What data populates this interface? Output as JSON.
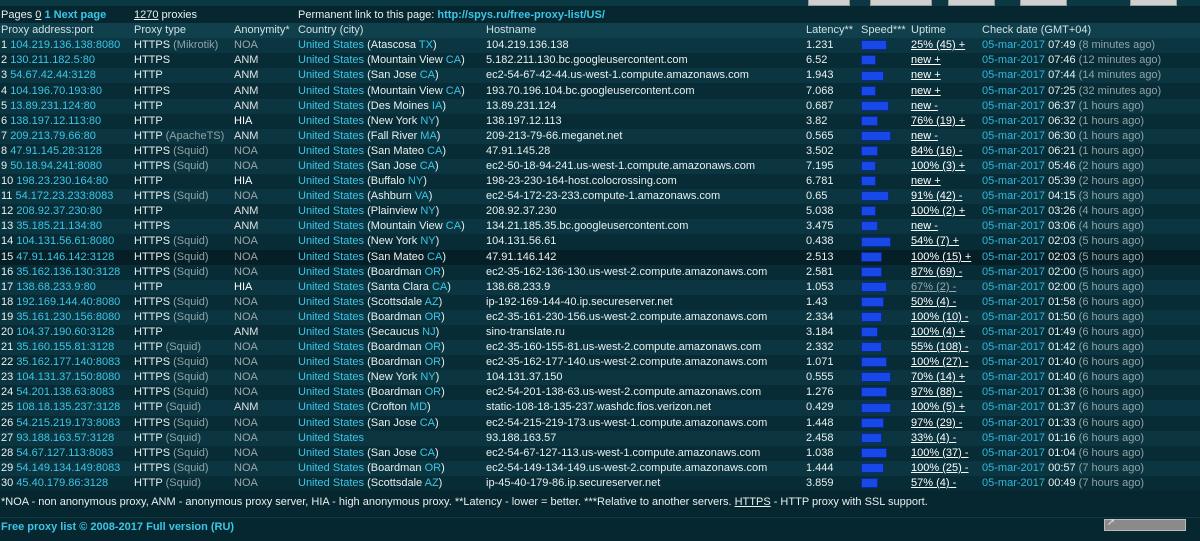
{
  "top": {
    "pages_label": "Pages",
    "current_page": "0",
    "next_page": "1 Next page",
    "total_proxies": "1270",
    "proxies_label": "proxies",
    "permalink_label": "Permanent link to this page:",
    "permalink": "http://spys.ru/free-proxy-list/US/"
  },
  "headers": [
    "Proxy address:port",
    "Proxy type",
    "Anonymity*",
    "Country (city)",
    "Hostname",
    "Latency**",
    "Speed***",
    "Uptime",
    "Check date (GMT+04)"
  ],
  "rows": [
    {
      "n": "1",
      "ip": "104.219.136.138:8080",
      "type": "HTTPS",
      "sub": "(Mikrotik)",
      "anon": "NOA",
      "country": "United States",
      "city": "Atascosa",
      "state": "TX",
      "host": "104.219.136.138",
      "lat": "1.231",
      "speed": 0.8,
      "uptime": "25% (45) +",
      "date": "05-mar-2017",
      "time": "07:49",
      "ago": "(8 minutes ago)"
    },
    {
      "n": "2",
      "ip": "130.211.182.5:80",
      "type": "HTTPS",
      "sub": "",
      "anon": "ANM",
      "country": "United States",
      "city": "Mountain View",
      "state": "CA",
      "host": "5.182.211.130.bc.googleusercontent.com",
      "lat": "6.52",
      "speed": 0.3,
      "uptime": "new +",
      "date": "05-mar-2017",
      "time": "07:46",
      "ago": "(12 minutes ago)"
    },
    {
      "n": "3",
      "ip": "54.67.42.44:3128",
      "type": "HTTP",
      "sub": "",
      "anon": "ANM",
      "country": "United States",
      "city": "San Jose",
      "state": "CA",
      "host": "ec2-54-67-42-44.us-west-1.compute.amazonaws.com",
      "lat": "1.943",
      "speed": 0.7,
      "uptime": "new +",
      "date": "05-mar-2017",
      "time": "07:44",
      "ago": "(14 minutes ago)"
    },
    {
      "n": "4",
      "ip": "104.196.70.193:80",
      "type": "HTTPS",
      "sub": "",
      "anon": "ANM",
      "country": "United States",
      "city": "Mountain View",
      "state": "CA",
      "host": "193.70.196.104.bc.googleusercontent.com",
      "lat": "7.068",
      "speed": 0.3,
      "uptime": "new +",
      "date": "05-mar-2017",
      "time": "07:25",
      "ago": "(32 minutes ago)"
    },
    {
      "n": "5",
      "ip": "13.89.231.124:80",
      "type": "HTTP",
      "sub": "",
      "anon": "ANM",
      "country": "United States",
      "city": "Des Moines",
      "state": "IA",
      "host": "13.89.231.124",
      "lat": "0.687",
      "speed": 0.9,
      "uptime": "new -",
      "date": "05-mar-2017",
      "time": "06:37",
      "ago": "(1 hours ago)"
    },
    {
      "n": "6",
      "ip": "138.197.12.113:80",
      "type": "HTTP",
      "sub": "",
      "anon": "HIA",
      "country": "United States",
      "city": "New York",
      "state": "NY",
      "host": "138.197.12.113",
      "lat": "3.82",
      "speed": 0.4,
      "uptime": "76% (19) +",
      "date": "05-mar-2017",
      "time": "06:32",
      "ago": "(1 hours ago)"
    },
    {
      "n": "7",
      "ip": "209.213.79.66:80",
      "type": "HTTP",
      "sub": "(ApacheTS)",
      "anon": "ANM",
      "country": "United States",
      "city": "Fall River",
      "state": "MA",
      "host": "209-213-79-66.meganet.net",
      "lat": "0.565",
      "speed": 1.0,
      "uptime": "new -",
      "date": "05-mar-2017",
      "time": "06:30",
      "ago": "(1 hours ago)"
    },
    {
      "n": "8",
      "ip": "47.91.145.28:3128",
      "type": "HTTPS",
      "sub": "(Squid)",
      "anon": "NOA",
      "country": "United States",
      "city": "San Mateo",
      "state": "CA",
      "host": "47.91.145.28",
      "lat": "3.502",
      "speed": 0.4,
      "uptime": "84% (16) -",
      "date": "05-mar-2017",
      "time": "06:21",
      "ago": "(1 hours ago)"
    },
    {
      "n": "9",
      "ip": "50.18.94.241:8080",
      "type": "HTTPS",
      "sub": "(Squid)",
      "anon": "NOA",
      "country": "United States",
      "city": "San Jose",
      "state": "CA",
      "host": "ec2-50-18-94-241.us-west-1.compute.amazonaws.com",
      "lat": "7.195",
      "speed": 0.3,
      "uptime": "100% (3) +",
      "date": "05-mar-2017",
      "time": "05:46",
      "ago": "(2 hours ago)"
    },
    {
      "n": "10",
      "ip": "198.23.230.164:80",
      "type": "HTTP",
      "sub": "",
      "anon": "HIA",
      "country": "United States",
      "city": "Buffalo",
      "state": "NY",
      "host": "198-23-230-164-host.colocrossing.com",
      "lat": "6.781",
      "speed": 0.3,
      "uptime": "new +",
      "date": "05-mar-2017",
      "time": "05:39",
      "ago": "(2 hours ago)"
    },
    {
      "n": "11",
      "ip": "54.172.23.233:8083",
      "type": "HTTPS",
      "sub": "(Squid)",
      "anon": "NOA",
      "country": "United States",
      "city": "Ashburn",
      "state": "VA",
      "host": "ec2-54-172-23-233.compute-1.amazonaws.com",
      "lat": "0.65",
      "speed": 0.9,
      "uptime": "91% (42) -",
      "date": "05-mar-2017",
      "time": "04:15",
      "ago": "(3 hours ago)"
    },
    {
      "n": "12",
      "ip": "208.92.37.230:80",
      "type": "HTTP",
      "sub": "",
      "anon": "ANM",
      "country": "United States",
      "city": "Plainview",
      "state": "NY",
      "host": "208.92.37.230",
      "lat": "5.038",
      "speed": 0.3,
      "uptime": "100% (2) +",
      "date": "05-mar-2017",
      "time": "03:26",
      "ago": "(4 hours ago)"
    },
    {
      "n": "13",
      "ip": "35.185.21.134:80",
      "type": "HTTPS",
      "sub": "",
      "anon": "ANM",
      "country": "United States",
      "city": "Mountain View",
      "state": "CA",
      "host": "134.21.185.35.bc.googleusercontent.com",
      "lat": "3.475",
      "speed": 0.4,
      "uptime": "new -",
      "date": "05-mar-2017",
      "time": "03:06",
      "ago": "(4 hours ago)"
    },
    {
      "n": "14",
      "ip": "104.131.56.61:8080",
      "type": "HTTPS",
      "sub": "(Squid)",
      "anon": "NOA",
      "country": "United States",
      "city": "New York",
      "state": "NY",
      "host": "104.131.56.61",
      "lat": "0.438",
      "speed": 1.0,
      "uptime": "54% (7) +",
      "date": "05-mar-2017",
      "time": "02:03",
      "ago": "(5 hours ago)"
    },
    {
      "n": "15",
      "ip": "47.91.146.142:3128",
      "type": "HTTPS",
      "sub": "(Squid)",
      "anon": "NOA",
      "country": "United States",
      "city": "San Mateo",
      "state": "CA",
      "host": "47.91.146.142",
      "lat": "2.513",
      "speed": 0.6,
      "uptime": "100% (15) +",
      "date": "05-mar-2017",
      "time": "02:03",
      "ago": "(5 hours ago)"
    },
    {
      "n": "16",
      "ip": "35.162.136.130:3128",
      "type": "HTTPS",
      "sub": "(Squid)",
      "anon": "NOA",
      "country": "United States",
      "city": "Boardman",
      "state": "OR",
      "host": "ec2-35-162-136-130.us-west-2.compute.amazonaws.com",
      "lat": "2.581",
      "speed": 0.6,
      "uptime": "87% (69) -",
      "date": "05-mar-2017",
      "time": "02:00",
      "ago": "(5 hours ago)"
    },
    {
      "n": "17",
      "ip": "138.68.233.9:80",
      "type": "HTTP",
      "sub": "",
      "anon": "HIA",
      "country": "United States",
      "city": "Santa Clara",
      "state": "CA",
      "host": "138.68.233.9",
      "lat": "1.053",
      "speed": 0.8,
      "uptime": "67% (2) -",
      "date": "05-mar-2017",
      "time": "02:00",
      "ago": "(5 hours ago)"
    },
    {
      "n": "18",
      "ip": "192.169.144.40:8080",
      "type": "HTTPS",
      "sub": "(Squid)",
      "anon": "NOA",
      "country": "United States",
      "city": "Scottsdale",
      "state": "AZ",
      "host": "ip-192-169-144-40.ip.secureserver.net",
      "lat": "1.43",
      "speed": 0.7,
      "uptime": "50% (4) -",
      "date": "05-mar-2017",
      "time": "01:58",
      "ago": "(6 hours ago)"
    },
    {
      "n": "19",
      "ip": "35.161.230.156:8080",
      "type": "HTTPS",
      "sub": "(Squid)",
      "anon": "NOA",
      "country": "United States",
      "city": "Boardman",
      "state": "OR",
      "host": "ec2-35-161-230-156.us-west-2.compute.amazonaws.com",
      "lat": "2.334",
      "speed": 0.6,
      "uptime": "100% (10) -",
      "date": "05-mar-2017",
      "time": "01:50",
      "ago": "(6 hours ago)"
    },
    {
      "n": "20",
      "ip": "104.37.190.60:3128",
      "type": "HTTP",
      "sub": "",
      "anon": "ANM",
      "country": "United States",
      "city": "Secaucus",
      "state": "NJ",
      "host": "sino-translate.ru",
      "lat": "3.184",
      "speed": 0.4,
      "uptime": "100% (4) +",
      "date": "05-mar-2017",
      "time": "01:49",
      "ago": "(6 hours ago)"
    },
    {
      "n": "21",
      "ip": "35.160.155.81:3128",
      "type": "HTTP",
      "sub": "(Squid)",
      "anon": "NOA",
      "country": "United States",
      "city": "Boardman",
      "state": "OR",
      "host": "ec2-35-160-155-81.us-west-2.compute.amazonaws.com",
      "lat": "2.332",
      "speed": 0.6,
      "uptime": "55% (108) -",
      "date": "05-mar-2017",
      "time": "01:42",
      "ago": "(6 hours ago)"
    },
    {
      "n": "22",
      "ip": "35.162.177.140:8083",
      "type": "HTTPS",
      "sub": "(Squid)",
      "anon": "NOA",
      "country": "United States",
      "city": "Boardman",
      "state": "OR",
      "host": "ec2-35-162-177-140.us-west-2.compute.amazonaws.com",
      "lat": "1.071",
      "speed": 0.8,
      "uptime": "100% (27) -",
      "date": "05-mar-2017",
      "time": "01:40",
      "ago": "(6 hours ago)"
    },
    {
      "n": "23",
      "ip": "104.131.37.150:8080",
      "type": "HTTPS",
      "sub": "(Squid)",
      "anon": "NOA",
      "country": "United States",
      "city": "New York",
      "state": "NY",
      "host": "104.131.37.150",
      "lat": "0.555",
      "speed": 1.0,
      "uptime": "70% (14) +",
      "date": "05-mar-2017",
      "time": "01:40",
      "ago": "(6 hours ago)"
    },
    {
      "n": "24",
      "ip": "54.201.138.63:8083",
      "type": "HTTPS",
      "sub": "(Squid)",
      "anon": "NOA",
      "country": "United States",
      "city": "Boardman",
      "state": "OR",
      "host": "ec2-54-201-138-63.us-west-2.compute.amazonaws.com",
      "lat": "1.276",
      "speed": 0.8,
      "uptime": "97% (88) -",
      "date": "05-mar-2017",
      "time": "01:38",
      "ago": "(6 hours ago)"
    },
    {
      "n": "25",
      "ip": "108.18.135.237:3128",
      "type": "HTTP",
      "sub": "(Squid)",
      "anon": "ANM",
      "country": "United States",
      "city": "Crofton",
      "state": "MD",
      "host": "static-108-18-135-237.washdc.fios.verizon.net",
      "lat": "0.429",
      "speed": 1.0,
      "uptime": "100% (5) +",
      "date": "05-mar-2017",
      "time": "01:37",
      "ago": "(6 hours ago)"
    },
    {
      "n": "26",
      "ip": "54.215.219.173:8083",
      "type": "HTTPS",
      "sub": "(Squid)",
      "anon": "NOA",
      "country": "United States",
      "city": "San Jose",
      "state": "CA",
      "host": "ec2-54-215-219-173.us-west-1.compute.amazonaws.com",
      "lat": "1.448",
      "speed": 0.7,
      "uptime": "97% (29) -",
      "date": "05-mar-2017",
      "time": "01:33",
      "ago": "(6 hours ago)"
    },
    {
      "n": "27",
      "ip": "93.188.163.57:3128",
      "type": "HTTP",
      "sub": "(Squid)",
      "anon": "NOA",
      "country": "United States",
      "city": "",
      "state": "",
      "host": "93.188.163.57",
      "lat": "2.458",
      "speed": 0.6,
      "uptime": "33% (4) -",
      "date": "05-mar-2017",
      "time": "01:16",
      "ago": "(6 hours ago)"
    },
    {
      "n": "28",
      "ip": "54.67.127.113:8083",
      "type": "HTTPS",
      "sub": "(Squid)",
      "anon": "NOA",
      "country": "United States",
      "city": "San Jose",
      "state": "CA",
      "host": "ec2-54-67-127-113.us-west-1.compute.amazonaws.com",
      "lat": "1.038",
      "speed": 0.8,
      "uptime": "100% (37) -",
      "date": "05-mar-2017",
      "time": "01:04",
      "ago": "(6 hours ago)"
    },
    {
      "n": "29",
      "ip": "54.149.134.149:8083",
      "type": "HTTPS",
      "sub": "(Squid)",
      "anon": "NOA",
      "country": "United States",
      "city": "Boardman",
      "state": "OR",
      "host": "ec2-54-149-134-149.us-west-2.compute.amazonaws.com",
      "lat": "1.444",
      "speed": 0.7,
      "uptime": "100% (25) -",
      "date": "05-mar-2017",
      "time": "00:57",
      "ago": "(7 hours ago)"
    },
    {
      "n": "30",
      "ip": "45.40.179.86:3128",
      "type": "HTTP",
      "sub": "(Squid)",
      "anon": "NOA",
      "country": "United States",
      "city": "Scottsdale",
      "state": "AZ",
      "host": "ip-45-40-179-86.ip.secureserver.net",
      "lat": "3.859",
      "speed": 0.4,
      "uptime": "57% (4) -",
      "date": "05-mar-2017",
      "time": "00:49",
      "ago": "(7 hours ago)"
    }
  ],
  "footnote": {
    "part1": "*NOA - non anonymous proxy, ANM - anonymous proxy server, HIA - high anonymous proxy. **Latency - lower = better. ***Relative to another servers.",
    "https": "HTTPS",
    "part2": " - HTTP proxy with SSL support."
  },
  "footer": {
    "copyright": "Free proxy list © 2008-2017",
    "full_version": "Full version (RU)"
  },
  "colors": {
    "background": "#06272f",
    "link": "#3bc6e8",
    "speed_bar": "#1848e8"
  }
}
